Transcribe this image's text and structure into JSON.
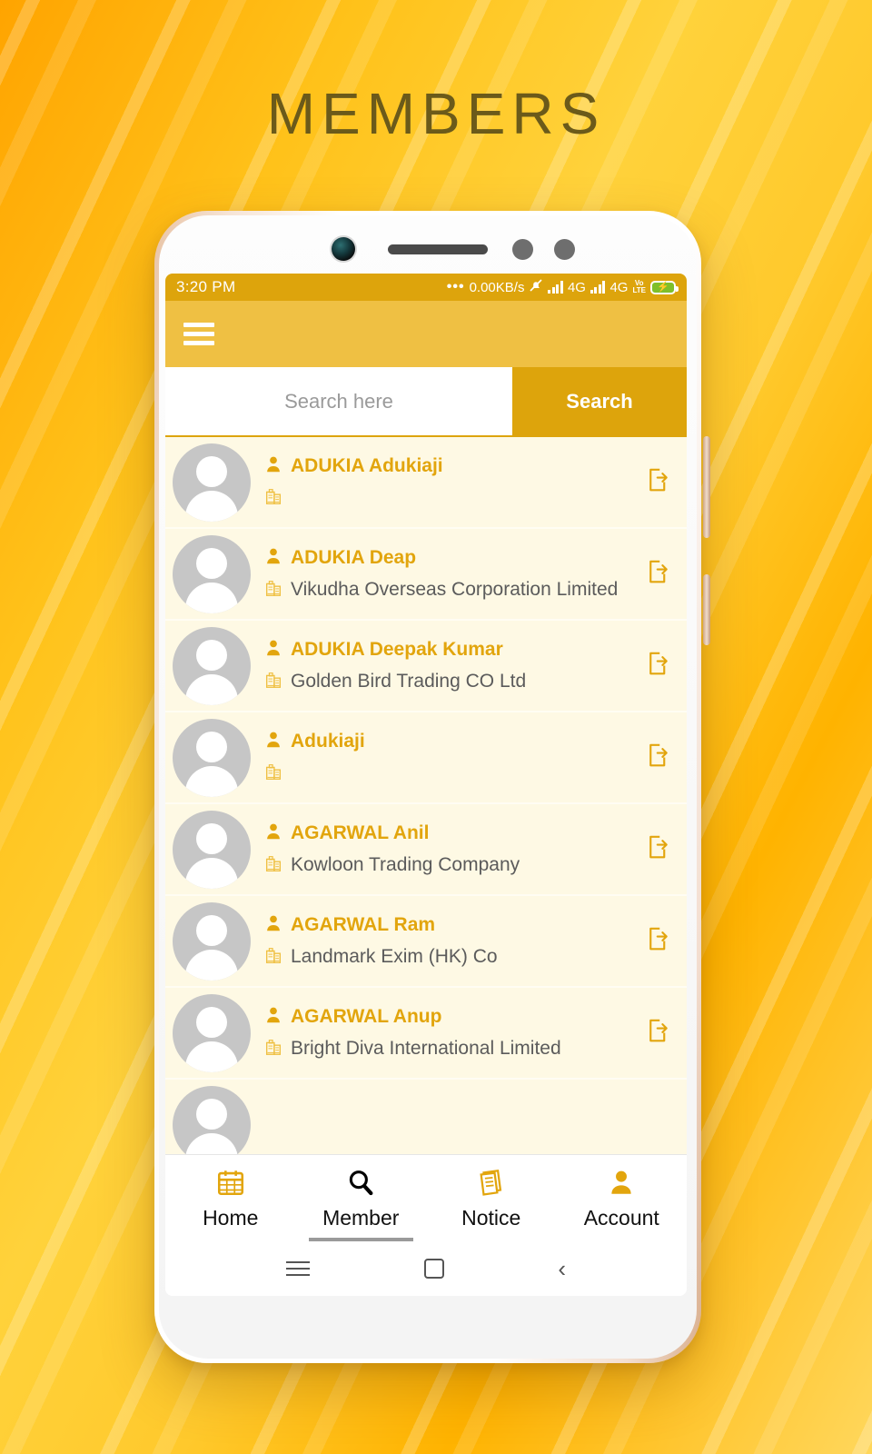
{
  "poster": {
    "title": "MEMBERS"
  },
  "statusbar": {
    "time": "3:20 PM",
    "dots": "•••",
    "datarate": "0.00KB/s",
    "network_1": "4G",
    "network_2": "4G",
    "volte_top": "Vo",
    "volte_bottom": "LTE",
    "mute_icon": "bell-muted-icon",
    "battery_icon": "battery-charging-icon"
  },
  "appbar": {
    "menu_icon": "hamburger-menu-icon"
  },
  "search": {
    "placeholder": "Search here",
    "value": "",
    "button_label": "Search"
  },
  "members": [
    {
      "name": "ADUKIA Adukiaji",
      "company": ""
    },
    {
      "name": "ADUKIA Deap",
      "company": "Vikudha Overseas Corporation Limited"
    },
    {
      "name": "ADUKIA Deepak Kumar",
      "company": "Golden Bird Trading CO Ltd"
    },
    {
      "name": "Adukiaji",
      "company": ""
    },
    {
      "name": "AGARWAL Anil",
      "company": "Kowloon Trading Company"
    },
    {
      "name": "AGARWAL Ram",
      "company": "Landmark Exim (HK) Co"
    },
    {
      "name": "AGARWAL Anup",
      "company": "Bright Diva International Limited"
    }
  ],
  "tabs": [
    {
      "label": "Home",
      "icon": "calendar-icon",
      "active": false
    },
    {
      "label": "Member",
      "icon": "search-icon",
      "active": true
    },
    {
      "label": "Notice",
      "icon": "notes-icon",
      "active": false
    },
    {
      "label": "Account",
      "icon": "person-icon",
      "active": false
    }
  ],
  "android_nav": {
    "recents_icon": "menu-icon",
    "home_icon": "square-icon",
    "back_icon": "back-chevron-icon"
  },
  "colors": {
    "accent_gold": "#DDA40C",
    "appbar_gold": "#EFC043",
    "name_gold": "#E2A50D",
    "list_bg": "#FEF9E4",
    "company_gray": "#5b5b5b",
    "title_olive": "#6b5a1a"
  }
}
